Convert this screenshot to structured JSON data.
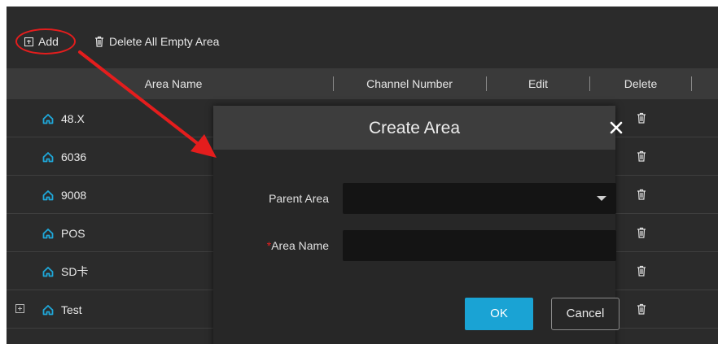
{
  "toolbar": {
    "add_label": "Add",
    "delete_all_label": "Delete All Empty Area"
  },
  "table": {
    "columns": [
      "Area Name",
      "Channel Number",
      "Edit",
      "Delete"
    ],
    "rows": [
      {
        "name": "48.X",
        "expandable": false
      },
      {
        "name": "6036",
        "expandable": false
      },
      {
        "name": "9008",
        "expandable": false
      },
      {
        "name": "POS",
        "expandable": false
      },
      {
        "name": "SD卡",
        "expandable": false
      },
      {
        "name": "Test",
        "expandable": true
      }
    ]
  },
  "dialog": {
    "title": "Create Area",
    "close_glyph": "✕",
    "parent_area_label": "Parent Area",
    "parent_area_value": "",
    "area_name_label": "Area Name",
    "required_mark": "*",
    "area_name_value": "",
    "ok_label": "OK",
    "cancel_label": "Cancel"
  },
  "colors": {
    "background": "#2b2b2b",
    "header": "#3a3a3a",
    "icon_accent": "#1fa7d8",
    "ok_button": "#1aa3d4",
    "annotation_red": "#e41d1d"
  }
}
